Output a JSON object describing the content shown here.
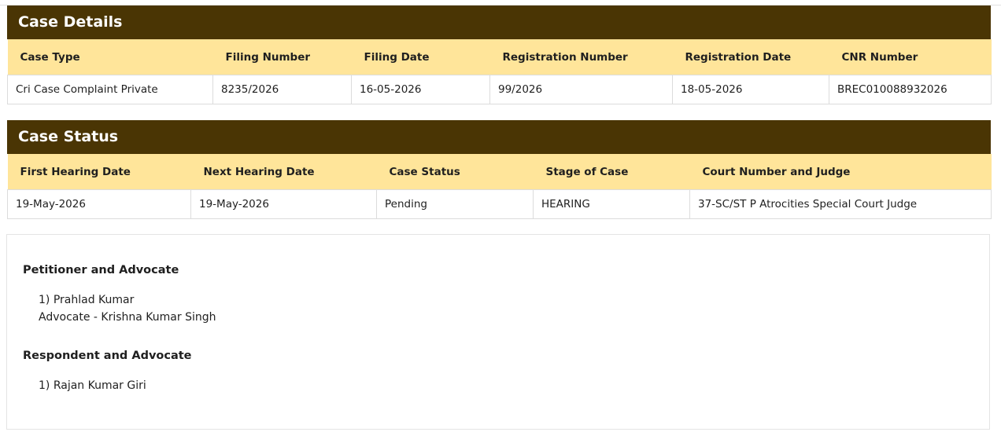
{
  "case_details": {
    "title": "Case Details",
    "headers": [
      "Case Type",
      "Filing Number",
      "Filing Date",
      "Registration Number",
      "Registration Date",
      "CNR Number"
    ],
    "row": [
      "Cri Case Complaint Private",
      "8235/2026",
      "16-05-2026",
      "99/2026",
      "18-05-2026",
      "BREC010088932026"
    ]
  },
  "case_status": {
    "title": "Case Status",
    "headers": [
      "First Hearing Date",
      "Next Hearing Date",
      "Case Status",
      "Stage of Case",
      "Court Number and Judge"
    ],
    "row": [
      "19-May-2026",
      "19-May-2026",
      "Pending",
      "HEARING",
      "37-SC/ST P Atrocities Special Court Judge"
    ]
  },
  "parties": {
    "petitioner_heading": "Petitioner and Advocate",
    "petitioner_lines": [
      "1) Prahlad Kumar",
      "Advocate - Krishna Kumar Singh"
    ],
    "respondent_heading": "Respondent and Advocate",
    "respondent_lines": [
      "1) Rajan Kumar Giri"
    ]
  },
  "colors": {
    "header_bg": "#4a3504",
    "column_header_bg": "#ffe59a",
    "border": "#dcdcdc"
  }
}
